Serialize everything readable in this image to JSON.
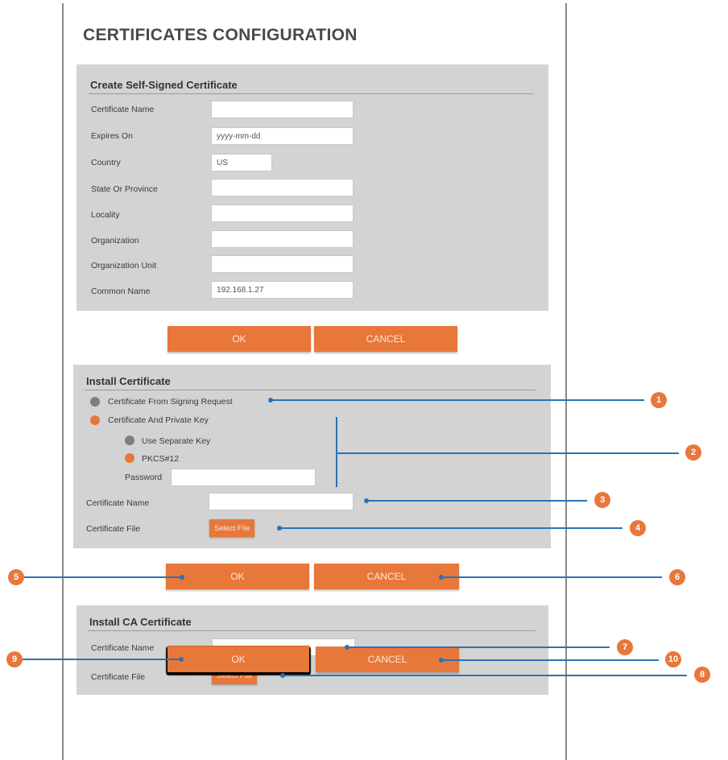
{
  "page": {
    "title": "CERTIFICATES CONFIGURATION"
  },
  "self_signed": {
    "title": "Create Self-Signed Certificate",
    "fields": [
      {
        "label": "Certificate Name",
        "value": ""
      },
      {
        "label": "Expires On",
        "value": "yyyy-mm-dd"
      },
      {
        "label": "Country",
        "value": "US"
      },
      {
        "label": "State Or Province",
        "value": ""
      },
      {
        "label": "Locality",
        "value": ""
      },
      {
        "label": "Organization",
        "value": ""
      },
      {
        "label": "Organization Unit",
        "value": ""
      },
      {
        "label": "Common Name",
        "value": "192.168.1.27"
      }
    ],
    "ok_label": "OK",
    "cancel_label": "CANCEL"
  },
  "install_cert": {
    "title": "Install Certificate",
    "option_signing_request": "Certificate From Signing Request",
    "option_private_key": "Certificate And Private Key",
    "option_separate_key": "Use Separate Key",
    "option_pkcs12": "PKCS#12",
    "password_label": "Password",
    "password_value": "",
    "cert_name_label": "Certificate Name",
    "cert_name_value": "",
    "cert_file_label": "Certificate File",
    "select_file_label": "Select File",
    "ok_label": "OK",
    "cancel_label": "CANCEL"
  },
  "install_ca": {
    "title": "Install CA Certificate",
    "cert_name_label": "Certificate Name",
    "cert_name_value": "",
    "cert_file_label": "Certificate File",
    "select_file_label": "Select File",
    "ok_label": "OK",
    "cancel_label": "CANCEL"
  },
  "callouts": [
    "1",
    "2",
    "3",
    "4",
    "5",
    "6",
    "7",
    "8",
    "9",
    "10"
  ],
  "colors": {
    "accent": "#e8773a",
    "callout_line": "#2a72b5",
    "panel": "#d3d3d3"
  }
}
